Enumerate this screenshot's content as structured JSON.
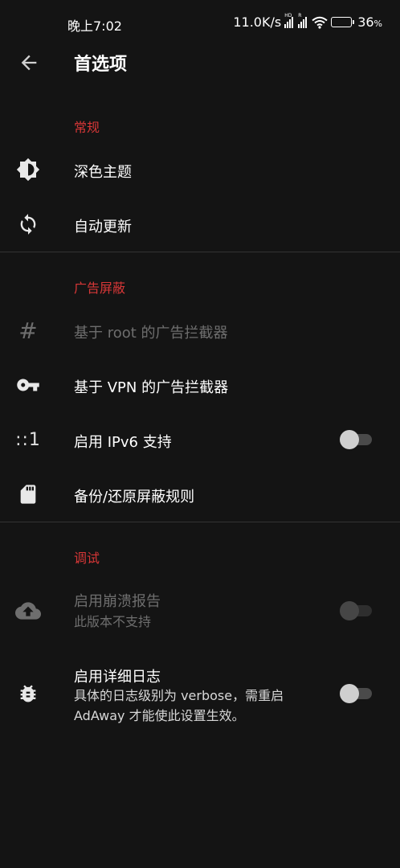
{
  "status_bar": {
    "time": "晚上7:02",
    "network_speed": "11.0K/s",
    "signal1_tag": "HD",
    "signal2_tag": "R",
    "battery_percent": "36",
    "battery_percent_sign": "%",
    "battery_level": 0.36
  },
  "app_bar": {
    "title": "首选项",
    "back_icon": "arrow-left-icon"
  },
  "sections": {
    "general": {
      "header": "常规",
      "dark_theme": {
        "label": "深色主题",
        "icon": "brightness-icon"
      },
      "auto_update": {
        "label": "自动更新",
        "icon": "sync-icon"
      }
    },
    "ad_blocking": {
      "header": "广告屏蔽",
      "root_blocker": {
        "label": "基于 root 的广告拦截器",
        "icon": "hash-icon",
        "icon_text": "#"
      },
      "vpn_blocker": {
        "label": "基于 VPN 的广告拦截器",
        "icon": "key-icon"
      },
      "ipv6": {
        "label": "启用 IPv6 支持",
        "icon": "ipv6-icon",
        "icon_text": "::1",
        "enabled": false
      },
      "backup": {
        "label": "备份/还原屏蔽规则",
        "icon": "sd-card-icon"
      }
    },
    "debug": {
      "header": "调试",
      "crash_report": {
        "label": "启用崩溃报告",
        "summary": "此版本不支持",
        "icon": "cloud-upload-icon",
        "enabled": false
      },
      "verbose_log": {
        "label": "启用详细日志",
        "summary": "具体的日志级别为 verbose，需重启 AdAway 才能使此设置生效。",
        "icon": "bug-icon",
        "enabled": false
      }
    }
  },
  "colors": {
    "background": "#141414",
    "accent": "#d73737",
    "text_primary": "#ffffff",
    "text_disabled": "#6e6e6e"
  }
}
